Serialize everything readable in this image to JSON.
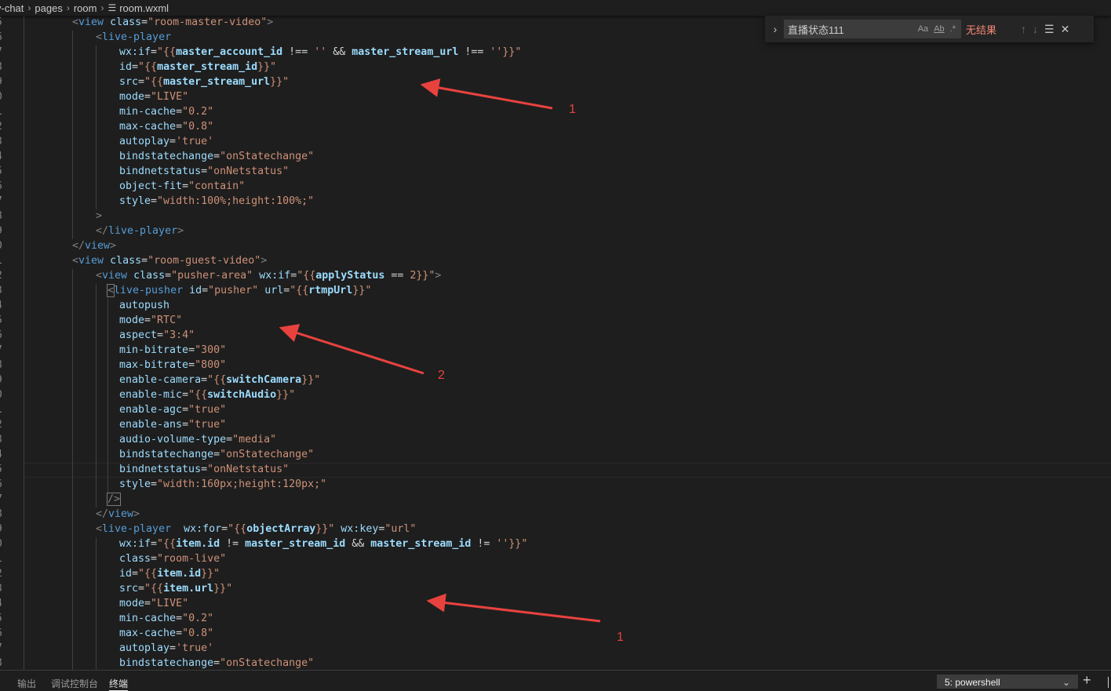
{
  "breadcrumb": {
    "items": [
      "y-chat",
      "pages",
      "room",
      "room.wxml"
    ],
    "separator": "›",
    "file_icon": "menu-lines-icon"
  },
  "find_widget": {
    "query": "直播状态111",
    "result": "无结果",
    "match_case": "Aa",
    "whole_word": "Ab",
    "regex": ".*"
  },
  "code": {
    "gutter": [
      "5",
      "6",
      "7",
      "8",
      "9",
      "0",
      "1",
      "2",
      "3",
      "4",
      "5",
      "6",
      "7",
      "8",
      "9",
      "0",
      "1",
      "2",
      "3",
      "4",
      "5",
      "6",
      "7",
      "8",
      "9",
      "0",
      "1",
      "2",
      "3",
      "4",
      "5",
      "6",
      "7",
      "8",
      "9",
      "0",
      "1",
      "2",
      "3",
      "4",
      "5",
      "6",
      "7",
      "8"
    ],
    "lines": [
      [
        [
          "tg",
          "<"
        ],
        [
          "tn",
          "view"
        ],
        [
          "op",
          " "
        ],
        [
          "an",
          "class"
        ],
        [
          "op",
          "="
        ],
        [
          "av",
          "\"room-master-video\""
        ],
        [
          "tg",
          ">"
        ]
      ],
      [
        [
          "tg",
          "<"
        ],
        [
          "tn",
          "live-player"
        ]
      ],
      [
        [
          "an",
          "wx:if"
        ],
        [
          "op",
          "="
        ],
        [
          "av",
          "\"{{"
        ],
        [
          "ex",
          "master_account_id"
        ],
        [
          "op",
          " !== "
        ],
        [
          "av",
          "''"
        ],
        [
          "op",
          " && "
        ],
        [
          "ex",
          "master_stream_url"
        ],
        [
          "op",
          " !== "
        ],
        [
          "av",
          "''"
        ],
        [
          "av",
          "}}\""
        ]
      ],
      [
        [
          "an",
          "id"
        ],
        [
          "op",
          "="
        ],
        [
          "av",
          "\"{{"
        ],
        [
          "ex",
          "master_stream_id"
        ],
        [
          "av",
          "}}\""
        ]
      ],
      [
        [
          "an",
          "src"
        ],
        [
          "op",
          "="
        ],
        [
          "av",
          "\"{{"
        ],
        [
          "ex",
          "master_stream_url"
        ],
        [
          "av",
          "}}\""
        ]
      ],
      [
        [
          "an",
          "mode"
        ],
        [
          "op",
          "="
        ],
        [
          "av",
          "\"LIVE\""
        ]
      ],
      [
        [
          "an",
          "min-cache"
        ],
        [
          "op",
          "="
        ],
        [
          "av",
          "\"0.2\""
        ]
      ],
      [
        [
          "an",
          "max-cache"
        ],
        [
          "op",
          "="
        ],
        [
          "av",
          "\"0.8\""
        ]
      ],
      [
        [
          "an",
          "autoplay"
        ],
        [
          "op",
          "="
        ],
        [
          "av",
          "'true'"
        ]
      ],
      [
        [
          "an",
          "bindstatechange"
        ],
        [
          "op",
          "="
        ],
        [
          "av",
          "\"onStatechange\""
        ]
      ],
      [
        [
          "an",
          "bindnetstatus"
        ],
        [
          "op",
          "="
        ],
        [
          "av",
          "\"onNetstatus\""
        ]
      ],
      [
        [
          "an",
          "object-fit"
        ],
        [
          "op",
          "="
        ],
        [
          "av",
          "\"contain\""
        ]
      ],
      [
        [
          "an",
          "style"
        ],
        [
          "op",
          "="
        ],
        [
          "av",
          "\"width:100%;height:100%;\""
        ]
      ],
      [
        [
          "tg",
          ">"
        ]
      ],
      [
        [
          "tg",
          "</"
        ],
        [
          "tn",
          "live-player"
        ],
        [
          "tg",
          ">"
        ]
      ],
      [
        [
          "tg",
          "</"
        ],
        [
          "tn",
          "view"
        ],
        [
          "tg",
          ">"
        ]
      ],
      [
        [
          "tg",
          "<"
        ],
        [
          "tn",
          "view"
        ],
        [
          "op",
          " "
        ],
        [
          "an",
          "class"
        ],
        [
          "op",
          "="
        ],
        [
          "av",
          "\"room-guest-video\""
        ],
        [
          "tg",
          ">"
        ]
      ],
      [
        [
          "tg",
          "<"
        ],
        [
          "tn",
          "view"
        ],
        [
          "op",
          " "
        ],
        [
          "an",
          "class"
        ],
        [
          "op",
          "="
        ],
        [
          "av",
          "\"pusher-area\""
        ],
        [
          "op",
          " "
        ],
        [
          "an",
          "wx:if"
        ],
        [
          "op",
          "="
        ],
        [
          "av",
          "\"{{"
        ],
        [
          "ex",
          "applyStatus"
        ],
        [
          "op",
          " == "
        ],
        [
          "av",
          "2"
        ],
        [
          "av",
          "}}\""
        ],
        [
          "tg",
          ">"
        ]
      ],
      [
        [
          "tg",
          "<"
        ],
        [
          "tn",
          "live-pusher"
        ],
        [
          "op",
          " "
        ],
        [
          "an",
          "id"
        ],
        [
          "op",
          "="
        ],
        [
          "av",
          "\"pusher\""
        ],
        [
          "op",
          " "
        ],
        [
          "an",
          "url"
        ],
        [
          "op",
          "="
        ],
        [
          "av",
          "\"{{"
        ],
        [
          "ex",
          "rtmpUrl"
        ],
        [
          "av",
          "}}\""
        ]
      ],
      [
        [
          "an",
          "autopush"
        ]
      ],
      [
        [
          "an",
          "mode"
        ],
        [
          "op",
          "="
        ],
        [
          "av",
          "\"RTC\""
        ]
      ],
      [
        [
          "an",
          "aspect"
        ],
        [
          "op",
          "="
        ],
        [
          "av",
          "\"3:4\""
        ]
      ],
      [
        [
          "an",
          "min-bitrate"
        ],
        [
          "op",
          "="
        ],
        [
          "av",
          "\"300\""
        ]
      ],
      [
        [
          "an",
          "max-bitrate"
        ],
        [
          "op",
          "="
        ],
        [
          "av",
          "\"800\""
        ]
      ],
      [
        [
          "an",
          "enable-camera"
        ],
        [
          "op",
          "="
        ],
        [
          "av",
          "\"{{"
        ],
        [
          "ex",
          "switchCamera"
        ],
        [
          "av",
          "}}\""
        ]
      ],
      [
        [
          "an",
          "enable-mic"
        ],
        [
          "op",
          "="
        ],
        [
          "av",
          "\"{{"
        ],
        [
          "ex",
          "switchAudio"
        ],
        [
          "av",
          "}}\""
        ]
      ],
      [
        [
          "an",
          "enable-agc"
        ],
        [
          "op",
          "="
        ],
        [
          "av",
          "\"true\""
        ]
      ],
      [
        [
          "an",
          "enable-ans"
        ],
        [
          "op",
          "="
        ],
        [
          "av",
          "\"true\""
        ]
      ],
      [
        [
          "an",
          "audio-volume-type"
        ],
        [
          "op",
          "="
        ],
        [
          "av",
          "\"media\""
        ]
      ],
      [
        [
          "an",
          "bindstatechange"
        ],
        [
          "op",
          "="
        ],
        [
          "av",
          "\"onStatechange\""
        ]
      ],
      [
        [
          "an",
          "bindnetstatus"
        ],
        [
          "op",
          "="
        ],
        [
          "av",
          "\"onNetstatus\""
        ]
      ],
      [
        [
          "an",
          "style"
        ],
        [
          "op",
          "="
        ],
        [
          "av",
          "\"width:160px;height:120px;\""
        ]
      ],
      [
        [
          "tg",
          "/>"
        ]
      ],
      [
        [
          "tg",
          "</"
        ],
        [
          "tn",
          "view"
        ],
        [
          "tg",
          ">"
        ]
      ],
      [
        [
          "tg",
          "<"
        ],
        [
          "tn",
          "live-player"
        ],
        [
          "op",
          "  "
        ],
        [
          "an",
          "wx:for"
        ],
        [
          "op",
          "="
        ],
        [
          "av",
          "\"{{"
        ],
        [
          "ex",
          "objectArray"
        ],
        [
          "av",
          "}}\""
        ],
        [
          "op",
          " "
        ],
        [
          "an",
          "wx:key"
        ],
        [
          "op",
          "="
        ],
        [
          "av",
          "\"url\""
        ]
      ],
      [
        [
          "an",
          "wx:if"
        ],
        [
          "op",
          "="
        ],
        [
          "av",
          "\"{{"
        ],
        [
          "ex",
          "item.id"
        ],
        [
          "op",
          " != "
        ],
        [
          "ex",
          "master_stream_id"
        ],
        [
          "op",
          " && "
        ],
        [
          "ex",
          "master_stream_id"
        ],
        [
          "op",
          " != "
        ],
        [
          "av",
          "''"
        ],
        [
          "av",
          "}}\""
        ]
      ],
      [
        [
          "an",
          "class"
        ],
        [
          "op",
          "="
        ],
        [
          "av",
          "\"room-live\""
        ]
      ],
      [
        [
          "an",
          "id"
        ],
        [
          "op",
          "="
        ],
        [
          "av",
          "\"{{"
        ],
        [
          "ex",
          "item.id"
        ],
        [
          "av",
          "}}\""
        ]
      ],
      [
        [
          "an",
          "src"
        ],
        [
          "op",
          "="
        ],
        [
          "av",
          "\"{{"
        ],
        [
          "ex",
          "item.url"
        ],
        [
          "av",
          "}}\""
        ]
      ],
      [
        [
          "an",
          "mode"
        ],
        [
          "op",
          "="
        ],
        [
          "av",
          "\"LIVE\""
        ]
      ],
      [
        [
          "an",
          "min-cache"
        ],
        [
          "op",
          "="
        ],
        [
          "av",
          "\"0.2\""
        ]
      ],
      [
        [
          "an",
          "max-cache"
        ],
        [
          "op",
          "="
        ],
        [
          "av",
          "\"0.8\""
        ]
      ],
      [
        [
          "an",
          "autoplay"
        ],
        [
          "op",
          "="
        ],
        [
          "av",
          "'true'"
        ]
      ],
      [
        [
          "an",
          "bindstatechange"
        ],
        [
          "op",
          "="
        ],
        [
          "av",
          "\"onStatechange\""
        ]
      ]
    ]
  },
  "annotations": {
    "label_1a": "1",
    "label_2": "2",
    "label_1b": "1",
    "arrow_color": "#e8423f"
  },
  "panel": {
    "tabs": [
      "输出",
      "调试控制台",
      "终端"
    ],
    "active_tab": "终端",
    "terminal_select": "5: powershell",
    "new_terminal": "+"
  },
  "colors": {
    "background": "#1e1e1e",
    "tag": "#569cd6",
    "attribute": "#9cdcfe",
    "string": "#ce9178",
    "no_results": "#f48771"
  }
}
